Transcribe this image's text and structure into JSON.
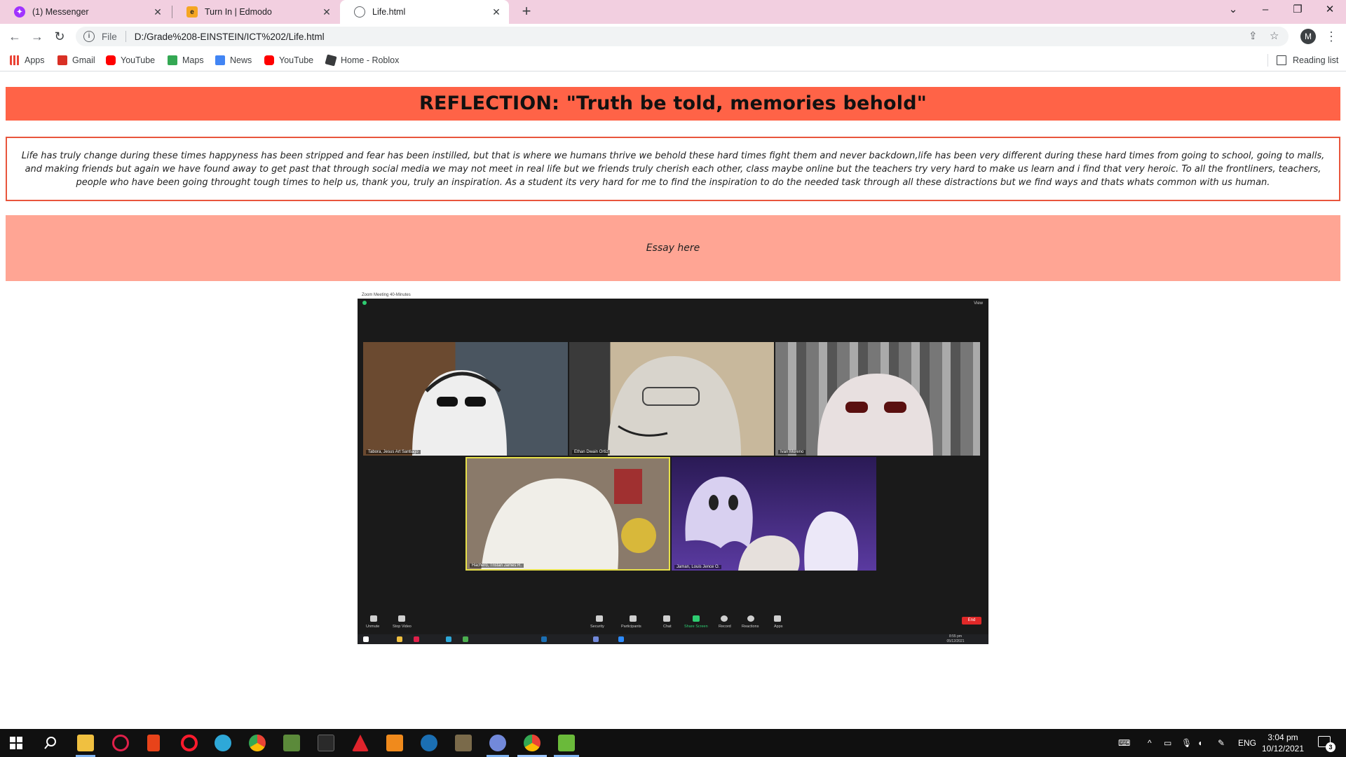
{
  "browser": {
    "tabs": [
      {
        "title": "(1) Messenger",
        "icon": "messenger-icon",
        "color": "#a033ff"
      },
      {
        "title": "Turn In | Edmodo",
        "icon": "edmodo-icon",
        "color": "#f5a623"
      },
      {
        "title": "Life.html",
        "icon": "globe-icon",
        "color": "#5f6368"
      }
    ],
    "address": {
      "scheme": "File",
      "url": "D:/Grade%208-EINSTEIN/ICT%202/Life.html"
    },
    "profile_initial": "M",
    "bookmarks": [
      {
        "label": "Apps",
        "icon": "apps-grid-icon",
        "color": "#ea4335"
      },
      {
        "label": "Gmail",
        "icon": "gmail-icon",
        "color": "#d93025"
      },
      {
        "label": "YouTube",
        "icon": "youtube-icon",
        "color": "#ff0000"
      },
      {
        "label": "Maps",
        "icon": "maps-icon",
        "color": "#34a853"
      },
      {
        "label": "News",
        "icon": "news-icon",
        "color": "#4285f4"
      },
      {
        "label": "YouTube",
        "icon": "youtube-icon",
        "color": "#ff0000"
      },
      {
        "label": "Home - Roblox",
        "icon": "roblox-icon",
        "color": "#393b3d"
      }
    ],
    "reading_list": "Reading list"
  },
  "page": {
    "title": "REFLECTION: \"Truth be told, memories behold\"",
    "reflection": "Life has truly change during these times happyness has been stripped and fear has been instilled, but that is where we humans thrive we behold these hard times fight them and never backdown,life has been very different during these hard times from going to school, going to malls, and making friends but again we have found away to get past that through social media we may not meet in real life but we friends truly cherish each other, class maybe online but the teachers try very hard to make us learn and i find that very heroic. To all the frontliners, teachers, people who have been going throught tough times to help us, thank you, truly an inspiration. As a student its very hard for me to find the inspiration to do the needed task through all these distractions but we find ways and thats whats common with us human.",
    "essay": "Essay here",
    "colors": {
      "banner": "#ff6347",
      "border": "#e8553c",
      "essay_bg": "#ffa594"
    }
  },
  "zoom_image": {
    "window_title": "Zoom Meeting 40-Minutes",
    "view_label": "View",
    "participants": [
      {
        "name": "Tabora, Jesus Art Santiago",
        "bg": "#6b5a4a"
      },
      {
        "name": "Ethan Dwain Ortiz",
        "bg": "#a89a84"
      },
      {
        "name": "Ivan Moreno",
        "bg": "#8a8a8a"
      },
      {
        "name": "Hachero, Tristan James R.",
        "bg": "#9a8a7a"
      },
      {
        "name": "Jaman, Louis Jence O.",
        "bg": "#3a2a6a"
      }
    ],
    "controls": [
      "Unmute",
      "Stop Video",
      "Security",
      "Participants",
      "Chat",
      "Share Screen",
      "Record",
      "Reactions",
      "Apps"
    ],
    "end_label": "End",
    "time": "8:55 pm",
    "date": "05/12/2021"
  },
  "taskbar": {
    "apps": [
      {
        "icon": "windows-start-icon",
        "color": "#ffffff"
      },
      {
        "icon": "search-icon",
        "color": "#ffffff"
      },
      {
        "icon": "file-explorer-icon",
        "color": "#f0c040"
      },
      {
        "icon": "opera-gx-icon",
        "color": "#e0204a"
      },
      {
        "icon": "office-icon",
        "color": "#e8431a"
      },
      {
        "icon": "opera-icon",
        "color": "#ff1b2d"
      },
      {
        "icon": "edge-icon",
        "color": "#2ea8d8"
      },
      {
        "icon": "chrome-icon",
        "color": "#4caf50"
      },
      {
        "icon": "minecraft-icon",
        "color": "#5b8a3a"
      },
      {
        "icon": "epic-games-icon",
        "color": "#2a2a2a"
      },
      {
        "icon": "adobe-icon",
        "color": "#e0242c"
      },
      {
        "icon": "vlc-icon",
        "color": "#f08a1c"
      },
      {
        "icon": "steam-icon",
        "color": "#1b6fb3"
      },
      {
        "icon": "game-icon",
        "color": "#7a6a4a"
      },
      {
        "icon": "discord-icon",
        "color": "#7289da"
      },
      {
        "icon": "chrome-profile-icon",
        "color": "#4caf50"
      },
      {
        "icon": "notepad-icon",
        "color": "#6aba3a"
      }
    ],
    "language": "ENG",
    "time": "3:04 pm",
    "date": "10/12/2021",
    "notifications": "3"
  }
}
